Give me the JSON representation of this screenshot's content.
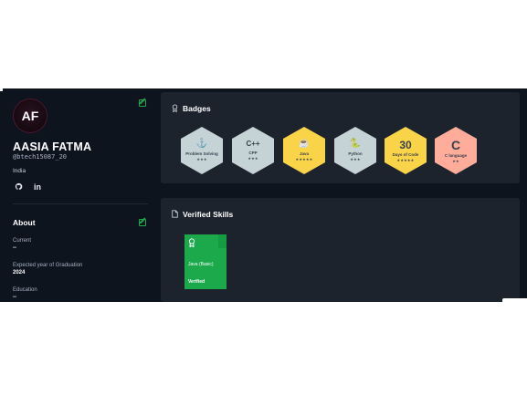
{
  "profile": {
    "initials": "AF",
    "name": "AASIA FATMA",
    "handle": "@btech15087_20",
    "country": "India",
    "social": {
      "github": "⟳",
      "linkedin": "in"
    }
  },
  "about": {
    "title": "About",
    "fields": [
      {
        "label": "Current",
        "value": "--"
      },
      {
        "label": "Expected year of Graduation",
        "value": "2024"
      },
      {
        "label": "Education",
        "value": "--"
      }
    ]
  },
  "badges": {
    "title": "Badges",
    "items": [
      {
        "name": "Problem Solving",
        "stars": "★★★",
        "color": "#c5d2d6",
        "icon": "⚓"
      },
      {
        "name": "CPP",
        "stars": "★★★",
        "color": "#c5d2d6",
        "icon": "C++"
      },
      {
        "name": "Java",
        "stars": "★★★★★",
        "color": "#f9d348",
        "icon": "☕"
      },
      {
        "name": "Python",
        "stars": "★★★",
        "color": "#c5d2d6",
        "icon": "🐍"
      },
      {
        "name": "Days of Code",
        "stars": "★★★★★",
        "color": "#f9d348",
        "icon": "30"
      },
      {
        "name": "C language",
        "stars": "★★",
        "color": "#ffac9a",
        "icon": "C"
      }
    ]
  },
  "skills": {
    "title": "Verified Skills",
    "items": [
      {
        "skill": "Java (Basic)",
        "status": "Verified"
      }
    ]
  },
  "colors": {
    "accent": "#1ba94c",
    "bg": "#0e141e",
    "card": "#1c232d"
  }
}
